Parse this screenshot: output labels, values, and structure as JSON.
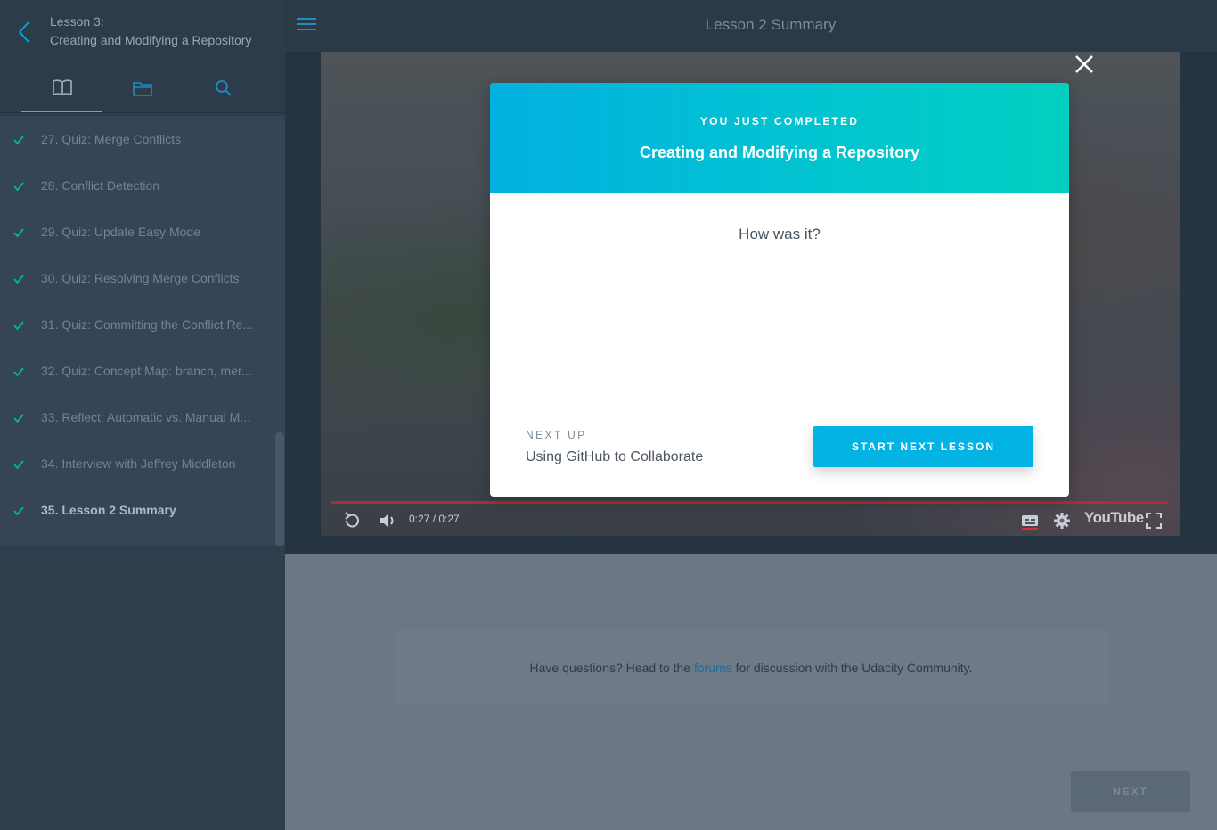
{
  "sidebar": {
    "lesson_number": "Lesson 3:",
    "lesson_title": "Creating and Modifying a Repository",
    "tabs": [
      {
        "name": "concepts",
        "icon": "book-icon",
        "active": true
      },
      {
        "name": "resources",
        "icon": "folder-icon",
        "active": false
      },
      {
        "name": "search",
        "icon": "search-icon",
        "active": false
      }
    ],
    "items": [
      {
        "label": "27. Quiz: Merge Conflicts",
        "done": true
      },
      {
        "label": "28. Conflict Detection",
        "done": true
      },
      {
        "label": "29. Quiz: Update Easy Mode",
        "done": true
      },
      {
        "label": "30. Quiz: Resolving Merge Conflicts",
        "done": true
      },
      {
        "label": "31. Quiz: Committing the Conflict Re...",
        "done": true
      },
      {
        "label": "32. Quiz: Concept Map: branch, mer...",
        "done": true
      },
      {
        "label": "33. Reflect: Automatic vs. Manual M...",
        "done": true
      },
      {
        "label": "34. Interview with Jeffrey Middleton",
        "done": true
      },
      {
        "label": "35. Lesson 2 Summary",
        "done": true,
        "current": true
      }
    ]
  },
  "header": {
    "title": "Lesson 2 Summary"
  },
  "video": {
    "time": "0:27 / 0:27",
    "provider": "YouTube",
    "progress": 1.0
  },
  "modal": {
    "completed_label": "YOU JUST COMPLETED",
    "completed_title": "Creating and Modifying a Repository",
    "question": "How was it?",
    "next_up_label": "NEXT UP",
    "next_up_title": "Using GitHub to Collaborate",
    "start_button": "START NEXT LESSON"
  },
  "footer": {
    "forum_prefix": "Have questions? Head to the ",
    "forum_link": "forums",
    "forum_suffix": " for discussion with the Udacity Community.",
    "next_button": "NEXT"
  },
  "colors": {
    "accent": "#02b3e4",
    "check": "#02b3a4",
    "sidebar_bg": "#2f3e4c"
  }
}
